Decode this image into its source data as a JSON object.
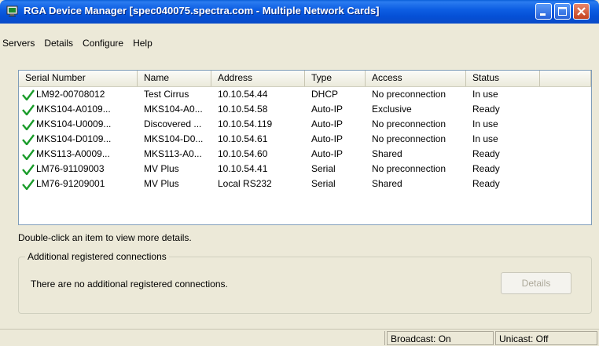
{
  "window": {
    "title": "RGA Device Manager [spec040075.spectra.com - Multiple Network Cards]"
  },
  "menu": [
    "Servers",
    "Details",
    "Configure",
    "Help"
  ],
  "devices": {
    "columns": [
      "Serial Number",
      "Name",
      "Address",
      "Type",
      "Access",
      "Status",
      ""
    ],
    "rows": [
      {
        "serial": "LM92-00708012",
        "name": "Test Cirrus",
        "address": "10.10.54.44",
        "type": "DHCP",
        "access": "No preconnection",
        "status": "In use"
      },
      {
        "serial": "MKS104-A0109...",
        "name": "MKS104-A0...",
        "address": "10.10.54.58",
        "type": "Auto-IP",
        "access": "Exclusive",
        "status": "Ready"
      },
      {
        "serial": "MKS104-U0009...",
        "name": "Discovered ...",
        "address": "10.10.54.119",
        "type": "Auto-IP",
        "access": "No preconnection",
        "status": "In use"
      },
      {
        "serial": "MKS104-D0109...",
        "name": "MKS104-D0...",
        "address": "10.10.54.61",
        "type": "Auto-IP",
        "access": "No preconnection",
        "status": "In use"
      },
      {
        "serial": "MKS113-A0009...",
        "name": "MKS113-A0...",
        "address": "10.10.54.60",
        "type": "Auto-IP",
        "access": "Shared",
        "status": "Ready"
      },
      {
        "serial": "LM76-91109003",
        "name": "MV Plus",
        "address": "10.10.54.41",
        "type": "Serial",
        "access": "No preconnection",
        "status": "Ready"
      },
      {
        "serial": "LM76-91209001",
        "name": "MV Plus",
        "address": "Local RS232",
        "type": "Serial",
        "access": "Shared",
        "status": "Ready"
      }
    ],
    "row_icon": "green-check-icon"
  },
  "hint": "Double-click an item to view more details.",
  "connections": {
    "legend": "Additional registered connections",
    "message": "There are no additional registered connections.",
    "details_label": "Details"
  },
  "statusbar": {
    "broadcast": "Broadcast: On",
    "unicast": "Unicast: Off"
  },
  "colors": {
    "titlebar": "#0550d6",
    "check": "#1a9c2a",
    "window_bg": "#ece9d8"
  }
}
